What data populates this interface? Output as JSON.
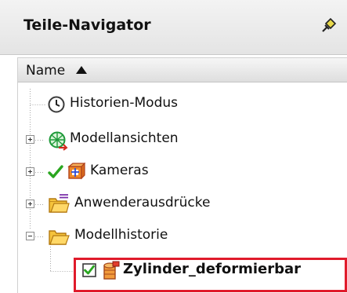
{
  "panel": {
    "title": "Teile-Navigator",
    "pin_icon": "pushpin-icon"
  },
  "table": {
    "header": "Name",
    "sort_icon": "sort-ascending-icon"
  },
  "tree": {
    "items": [
      {
        "label": "Historien-Modus",
        "icon": "clock-icon",
        "expander": "none"
      },
      {
        "label": "Modellansichten",
        "icon": "model-views-icon",
        "expander": "collapsed"
      },
      {
        "label": "Kameras",
        "icon": "camera-icon",
        "status_icon": "checkmark-icon",
        "expander": "collapsed"
      },
      {
        "label": "Anwenderausdrücke",
        "icon": "folder-expressions-icon",
        "expander": "collapsed"
      },
      {
        "label": "Modellhistorie",
        "icon": "folder-open-icon",
        "expander": "expanded"
      },
      {
        "label": "Zylinder_deformierbar",
        "icon": "deformable-cylinder-icon",
        "checkbox_checked": true,
        "highlighted": true
      }
    ]
  },
  "colors": {
    "highlight_border": "#e01b2b",
    "check_green": "#2aa620",
    "folder_yellow": "#f5c33b"
  }
}
